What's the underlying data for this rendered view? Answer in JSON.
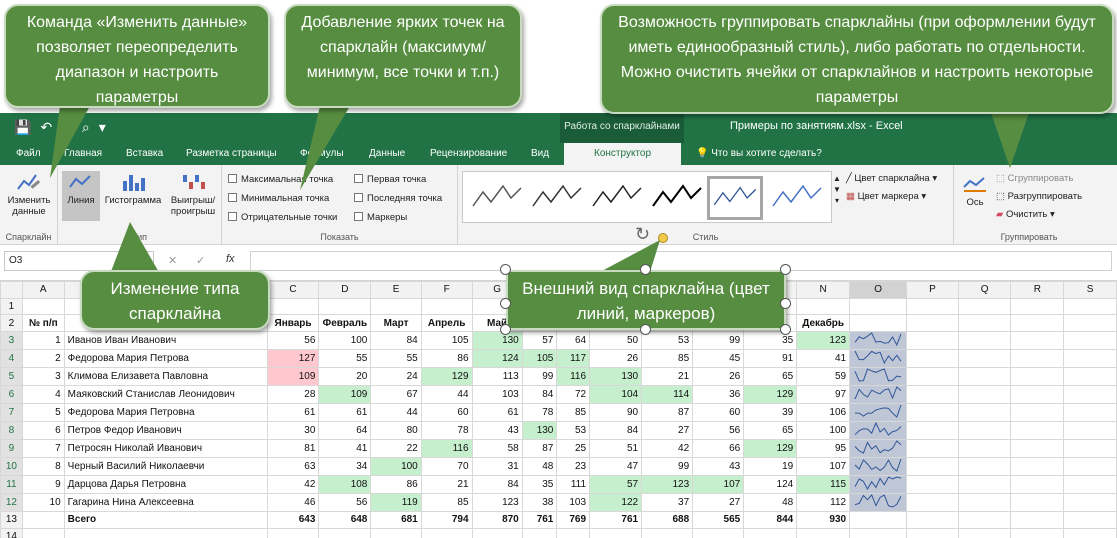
{
  "callouts": {
    "edit_data": "Команда «Изменить данные» позволяет переопределить диапазон и настроить параметры",
    "markers": "Добавление ярких точек на спарклайн (максимум/ минимум, все точки и т.п.)",
    "group": "Возможность группировать спарклайны (при оформлении будут иметь единообразный стиль), либо работать по отдельности. Можно очистить ячейки от спарклайнов и настроить некоторые параметры",
    "type": "Изменение типа спарклайна",
    "style": "Внешний вид спарклайна (цвет линий, маркеров)"
  },
  "titlebar": {
    "context_tab": "Работа со спарклайнами",
    "document_title": "Примеры по занятиям.xlsx - Excel"
  },
  "tabs": [
    "Файл",
    "Главная",
    "Вставка",
    "Разметка страницы",
    "Формулы",
    "Данные",
    "Рецензирование",
    "Вид",
    "Конструктор"
  ],
  "tell_me": "Что вы хотите сделать?",
  "ribbon": {
    "sparkline_group": {
      "label": "Спарклайн",
      "edit_data": "Изменить данные"
    },
    "type_group": {
      "label": "Тип",
      "line": "Линия",
      "column": "Гистограмма",
      "winloss": "Выигрыш/ проигрыш"
    },
    "show_group": {
      "label": "Показать",
      "high_point": "Максимальная точка",
      "low_point": "Минимальная точка",
      "negative_points": "Отрицательные точки",
      "first_point": "Первая точка",
      "last_point": "Последняя точка",
      "markers": "Маркеры"
    },
    "style_group": {
      "label": "Стиль",
      "sparkline_color": "Цвет спарклайна",
      "marker_color": "Цвет маркера"
    },
    "group_group": {
      "label": "Группировать",
      "axis": "Ось",
      "group": "Сгруппировать",
      "ungroup": "Разгруппировать",
      "clear": "Очистить"
    }
  },
  "formula_bar": {
    "name_box": "O3",
    "fx": "fx"
  },
  "columns": [
    "A",
    "B",
    "C",
    "D",
    "E",
    "F",
    "G",
    "H",
    "I",
    "J",
    "K",
    "L",
    "M",
    "N",
    "O",
    "P",
    "Q",
    "R",
    "S"
  ],
  "header_row": {
    "num": "№ п/п",
    "months": [
      "Январь",
      "Февраль",
      "Март",
      "Апрель",
      "Май",
      "",
      "",
      "",
      "",
      "",
      "",
      "Декабрь"
    ]
  },
  "rows": [
    {
      "n": "1",
      "name": "Иванов Иван Иванович",
      "vals": [
        "56",
        "100",
        "84",
        "105",
        "130",
        "57",
        "64",
        "50",
        "53",
        "99",
        "35",
        "123"
      ]
    },
    {
      "n": "2",
      "name": "Федорова Мария Петрова",
      "vals": [
        "127",
        "55",
        "55",
        "86",
        "124",
        "105",
        "117",
        "26",
        "85",
        "45",
        "91",
        "41"
      ]
    },
    {
      "n": "3",
      "name": "Климова Елизавета Павловна",
      "vals": [
        "109",
        "20",
        "24",
        "129",
        "113",
        "99",
        "116",
        "130",
        "21",
        "26",
        "65",
        "59"
      ]
    },
    {
      "n": "4",
      "name": "Маяковский Станислав Леонидович",
      "vals": [
        "28",
        "109",
        "67",
        "44",
        "103",
        "84",
        "72",
        "104",
        "114",
        "36",
        "129",
        "97"
      ]
    },
    {
      "n": "5",
      "name": "Федорова Мария Петровна",
      "vals": [
        "61",
        "61",
        "44",
        "60",
        "61",
        "78",
        "85",
        "90",
        "87",
        "60",
        "39",
        "106"
      ]
    },
    {
      "n": "6",
      "name": "Петров Федор Иванович",
      "vals": [
        "30",
        "64",
        "80",
        "78",
        "43",
        "130",
        "53",
        "84",
        "27",
        "56",
        "65",
        "100"
      ]
    },
    {
      "n": "7",
      "name": "Петросян Николай Иванович",
      "vals": [
        "81",
        "41",
        "22",
        "116",
        "58",
        "87",
        "25",
        "51",
        "42",
        "66",
        "129",
        "95"
      ]
    },
    {
      "n": "8",
      "name": "Черный Василий Николаевчи",
      "vals": [
        "63",
        "34",
        "100",
        "70",
        "31",
        "48",
        "23",
        "47",
        "99",
        "43",
        "19",
        "107"
      ]
    },
    {
      "n": "9",
      "name": "Дарцова Дарья Петровна",
      "vals": [
        "42",
        "108",
        "86",
        "21",
        "84",
        "35",
        "111",
        "57",
        "123",
        "107",
        "124",
        "115"
      ]
    },
    {
      "n": "10",
      "name": "Гагарина Нина Алексеевна",
      "vals": [
        "46",
        "56",
        "119",
        "85",
        "123",
        "38",
        "103",
        "122",
        "37",
        "27",
        "48",
        "112"
      ]
    }
  ],
  "total_row": {
    "label": "Всего",
    "vals": [
      "643",
      "648",
      "681",
      "794",
      "870",
      "761",
      "769",
      "761",
      "688",
      "565",
      "844",
      "930"
    ]
  }
}
